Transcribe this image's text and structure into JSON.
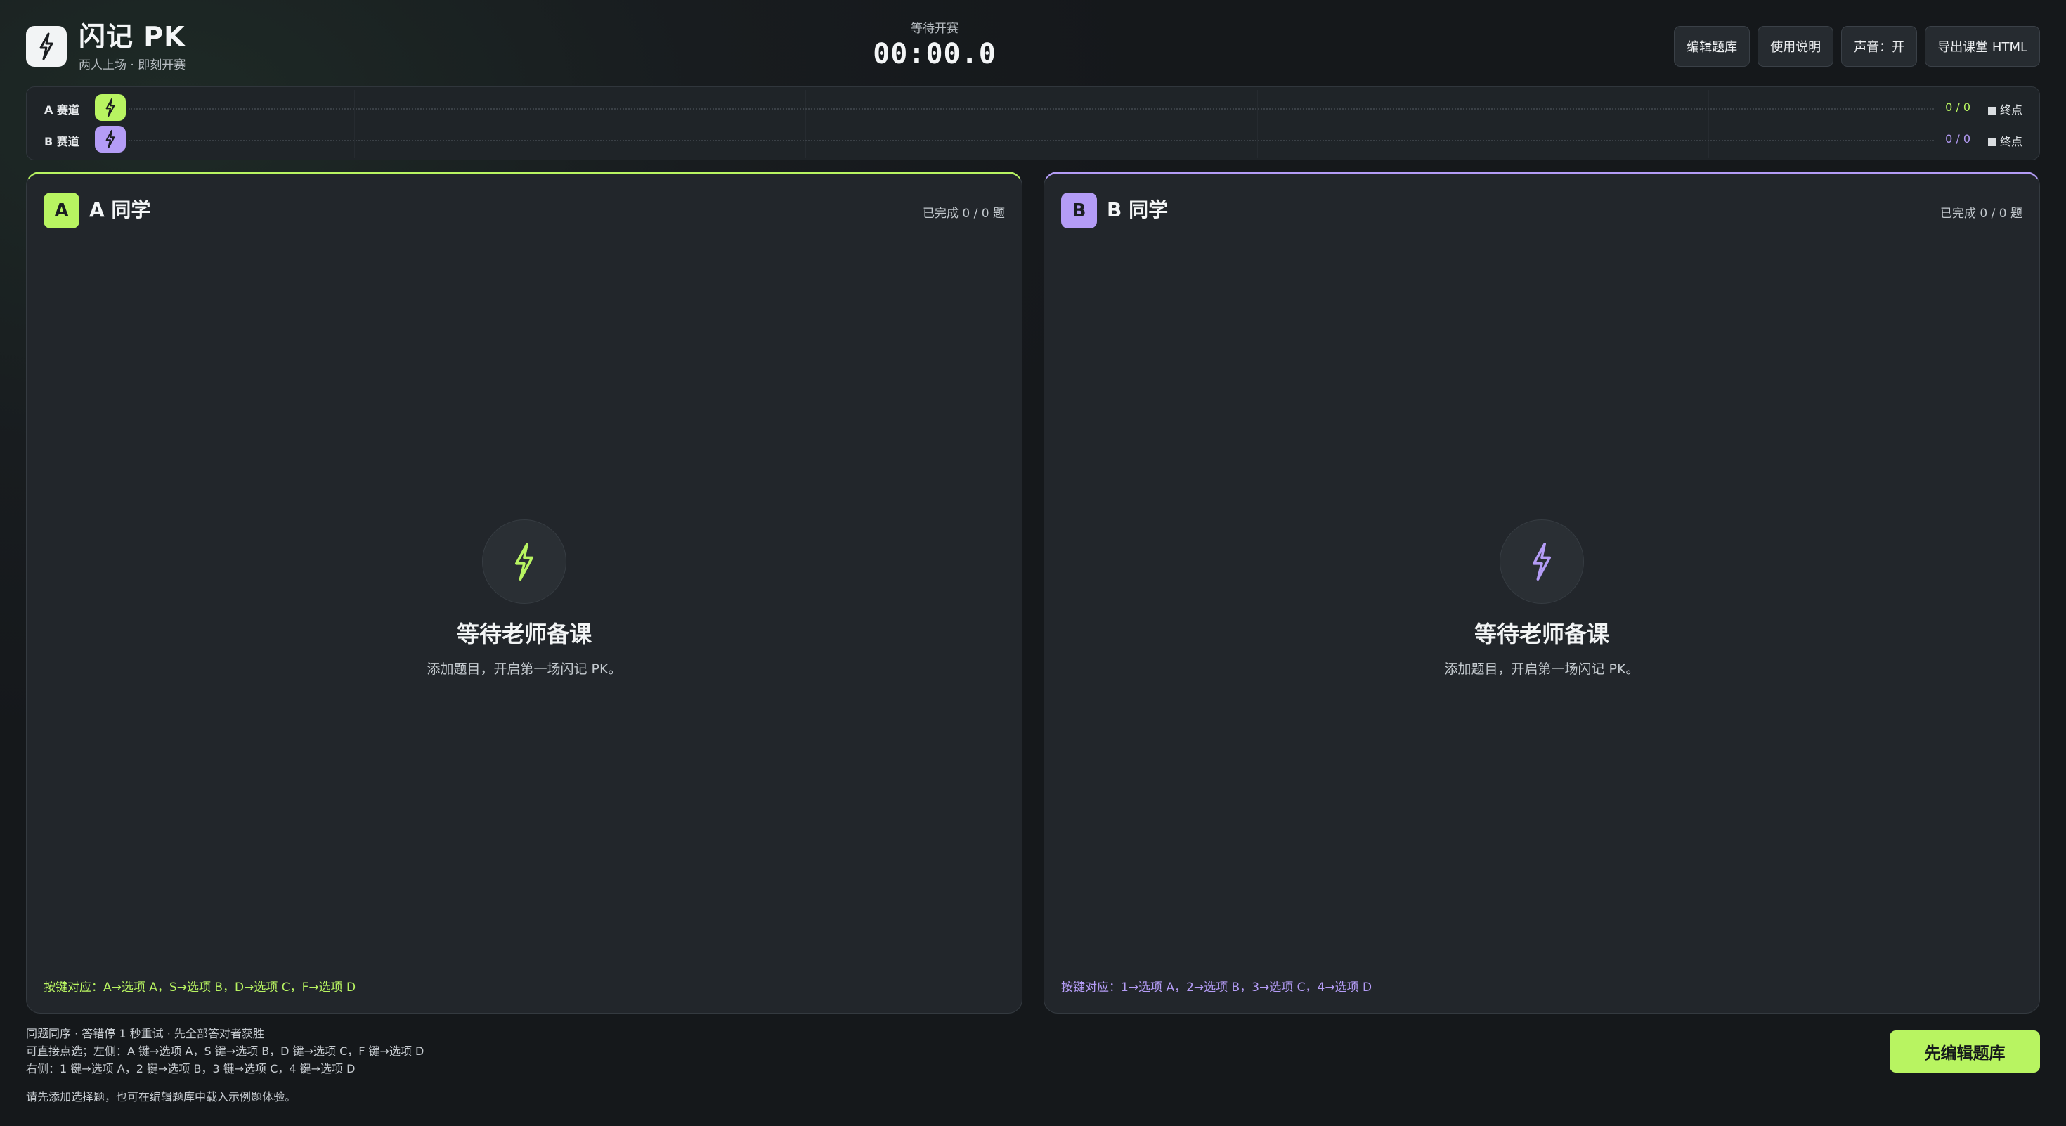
{
  "app": {
    "title": "闪记 PK",
    "subtitle": "两人上场 · 即刻开赛"
  },
  "timer": {
    "status": "等待开赛",
    "value": "00:00.0"
  },
  "toolbar": {
    "edit_bank": "编辑题库",
    "instructions": "使用说明",
    "sound": "声音：开",
    "export": "导出课堂 HTML"
  },
  "track": {
    "lanes": [
      {
        "label": "A 赛道",
        "count": "0 / 0",
        "finish": "终点",
        "progress": 0
      },
      {
        "label": "B 赛道",
        "count": "0 / 0",
        "finish": "终点",
        "progress": 0
      }
    ]
  },
  "players": {
    "a": {
      "badge": "A",
      "name": "A 同学",
      "progress": "已完成 0 / 0 题",
      "empty_title": "等待老师备课",
      "empty_desc": "添加题目，开启第一场闪记 PK。",
      "key_hint": "按键对应：A→选项 A，S→选项 B，D→选项 C，F→选项 D"
    },
    "b": {
      "badge": "B",
      "name": "B 同学",
      "progress": "已完成 0 / 0 题",
      "empty_title": "等待老师备课",
      "empty_desc": "添加题目，开启第一场闪记 PK。",
      "key_hint": "按键对应：1→选项 A，2→选项 B，3→选项 C，4→选项 D"
    }
  },
  "footer": {
    "rules": "同题同序 · 答错停 1 秒重试 · 先全部答对者获胜",
    "left_keys": "可直接点选；左侧：A 键→选项 A，S 键→选项 B，D 键→选项 C，F 键→选项 D",
    "right_keys": "右侧：1 键→选项 A，2 键→选项 B，3 键→选项 C，4 键→选项 D",
    "tip": "请先添加选择题，也可在编辑题库中载入示例题体验。",
    "primary_button": "先编辑题库"
  },
  "colors": {
    "accent_a": "#b8f461",
    "accent_b": "#b49cf6",
    "background": "#181c1f",
    "panel": "#22262b"
  },
  "icons": {
    "logo": "lightning-bolt-icon",
    "runner": "lightning-bolt-icon",
    "empty": "lightning-bolt-icon",
    "finish": "finish-square-icon"
  }
}
